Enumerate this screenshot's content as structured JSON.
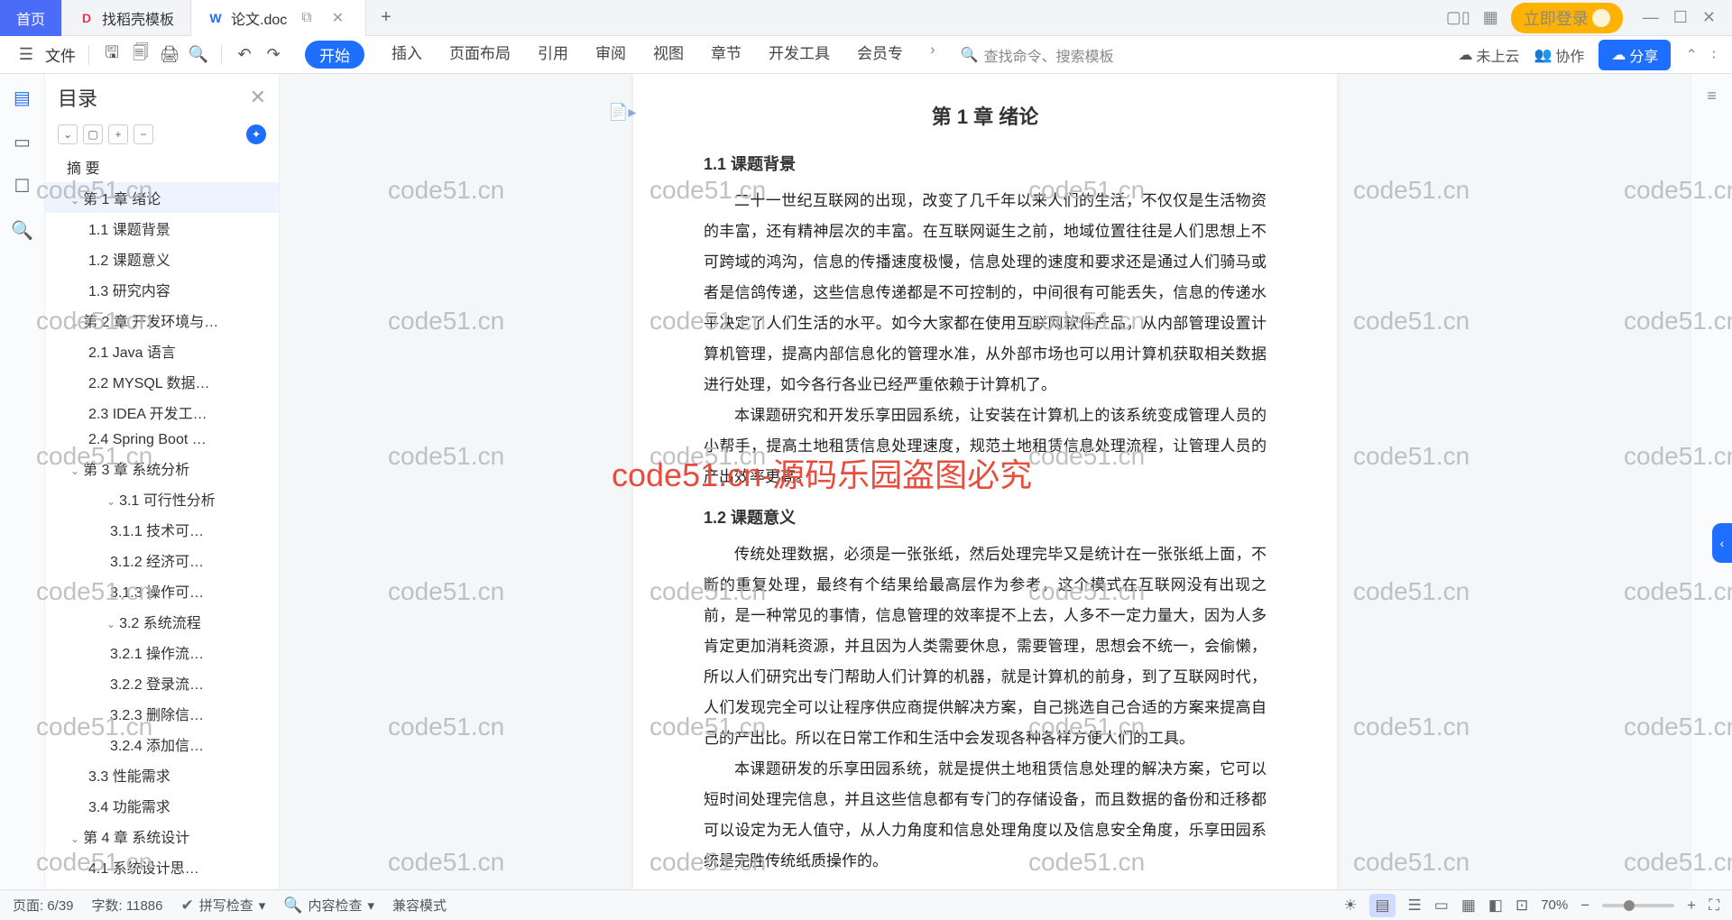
{
  "tabs": {
    "home": "首页",
    "template": "找稻壳模板",
    "doc": "论文.doc"
  },
  "login": "立即登录",
  "fileLabel": "文件",
  "menus": {
    "start": "开始",
    "insert": "插入",
    "layout": "页面布局",
    "ref": "引用",
    "review": "审阅",
    "view": "视图",
    "chapter": "章节",
    "dev": "开发工具",
    "member": "会员专"
  },
  "searchPlaceholder": "查找命令、搜索模板",
  "cloud": "未上云",
  "collab": "协作",
  "share": "分享",
  "outlineTitle": "目录",
  "toc": [
    {
      "l": 0,
      "t": "摘  要"
    },
    {
      "l": 1,
      "t": "第 1 章  绪论",
      "sel": true,
      "c": true
    },
    {
      "l": 2,
      "t": "1.1  课题背景"
    },
    {
      "l": 2,
      "t": "1.2  课题意义"
    },
    {
      "l": 2,
      "t": "1.3  研究内容"
    },
    {
      "l": 1,
      "t": "第 2 章  开发环境与…",
      "c": true
    },
    {
      "l": 2,
      "t": "2.1 Java 语言"
    },
    {
      "l": 2,
      "t": "2.2 MYSQL 数据…"
    },
    {
      "l": 2,
      "t": "2.3 IDEA 开发工…"
    },
    {
      "l": 2,
      "t": "2.4 Spring Boot …"
    },
    {
      "l": 1,
      "t": "第 3 章  系统分析",
      "c": true
    },
    {
      "l": 3,
      "t": "3.1  可行性分析",
      "c": true
    },
    {
      "l": 4,
      "t": "3.1.1  技术可…"
    },
    {
      "l": 4,
      "t": "3.1.2  经济可…"
    },
    {
      "l": 4,
      "t": "3.1.3  操作可…"
    },
    {
      "l": 3,
      "t": "3.2  系统流程",
      "c": true
    },
    {
      "l": 4,
      "t": "3.2.1  操作流…"
    },
    {
      "l": 4,
      "t": "3.2.2  登录流…"
    },
    {
      "l": 4,
      "t": "3.2.3  删除信…"
    },
    {
      "l": 4,
      "t": "3.2.4  添加信…"
    },
    {
      "l": 2,
      "t": "3.3  性能需求"
    },
    {
      "l": 2,
      "t": "3.4  功能需求"
    },
    {
      "l": 1,
      "t": "第 4 章  系统设计",
      "c": true
    },
    {
      "l": 2,
      "t": "4.1  系统设计思…"
    }
  ],
  "doc": {
    "chapter": "第 1 章  绪论",
    "s11": "1.1  课题背景",
    "p1": "二十一世纪互联网的出现，改变了几千年以来人们的生活，不仅仅是生活物资的丰富，还有精神层次的丰富。在互联网诞生之前，地域位置往往是人们思想上不可跨域的鸿沟，信息的传播速度极慢，信息处理的速度和要求还是通过人们骑马或者是信鸽传递，这些信息传递都是不可控制的，中间很有可能丢失，信息的传递水平决定了人们生活的水平。如今大家都在使用互联网软件产品，从内部管理设置计算机管理，提高内部信息化的管理水准，从外部市场也可以用计算机获取相关数据进行处理，如今各行各业已经严重依赖于计算机了。",
    "p2": "本课题研究和开发乐享田园系统，让安装在计算机上的该系统变成管理人员的小帮手，提高土地租赁信息处理速度，规范土地租赁信息处理流程，让管理人员的产出效率更高。",
    "s12": "1.2  课题意义",
    "p3": "传统处理数据，必须是一张张纸，然后处理完毕又是统计在一张张纸上面，不断的重复处理，最终有个结果给最高层作为参考，这个模式在互联网没有出现之前，是一种常见的事情，信息管理的效率提不上去，人多不一定力量大，因为人多肯定更加消耗资源，并且因为人类需要休息，需要管理，思想会不统一，会偷懒，所以人们研究出专门帮助人们计算的机器，就是计算机的前身，到了互联网时代，人们发现完全可以让程序供应商提供解决方案，自己挑选自己合适的方案来提高自己的产出比。所以在日常工作和生活中会发现各种各样方便人们的工具。",
    "p4": "本课题研发的乐享田园系统，就是提供土地租赁信息处理的解决方案，它可以短时间处理完信息，并且这些信息都有专门的存储设备，而且数据的备份和迁移都可以设定为无人值守，从人力角度和信息处理角度以及信息安全角度，乐享田园系统是完胜传统纸质操作的。"
  },
  "watermarkRed": "code51.cn-源码乐园盗图必究",
  "wmGray": "code51.cn",
  "status": {
    "page": "页面: 6/39",
    "words": "字数: 11886",
    "spell": "拼写检查",
    "content": "内容检查",
    "compat": "兼容模式",
    "zoom": "70%"
  }
}
